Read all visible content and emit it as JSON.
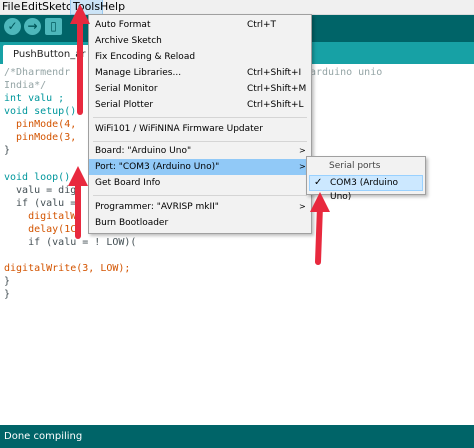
{
  "menubar": {
    "items": [
      "File",
      "Edit",
      "Sketch",
      "Tools",
      "Help"
    ]
  },
  "editor": {
    "tab_label": "PushButton_ar",
    "lines": [
      "/*Dharmendr",
      "India*/",
      "int valu ;",
      "void setup()",
      "  pinMode(4,",
      "  pinMode(3,",
      "}",
      "void loop()",
      "  valu = dig",
      "  if (valu =",
      "    digitalW",
      "    delay(1C",
      "    if (valu = ! LOW)(",
      "digitalWrite(3, LOW);",
      "}",
      "}"
    ],
    "comment_tail": "arduino unio"
  },
  "tools_menu": {
    "items": [
      {
        "label": "Auto Format",
        "shortcut": "Ctrl+T"
      },
      {
        "label": "Archive Sketch",
        "shortcut": ""
      },
      {
        "label": "Fix Encoding & Reload",
        "shortcut": ""
      },
      {
        "label": "Manage Libraries...",
        "shortcut": "Ctrl+Shift+I"
      },
      {
        "label": "Serial Monitor",
        "shortcut": "Ctrl+Shift+M"
      },
      {
        "label": "Serial Plotter",
        "shortcut": "Ctrl+Shift+L"
      },
      {
        "label": "WiFi101 / WiFiNINA Firmware Updater",
        "shortcut": ""
      },
      {
        "label": "Board: \"Arduino Uno\"",
        "shortcut": ""
      },
      {
        "label": "Port: \"COM3 (Arduino Uno)\"",
        "shortcut": ""
      },
      {
        "label": "Get Board Info",
        "shortcut": ""
      },
      {
        "label": "Programmer: \"AVRISP mkII\"",
        "shortcut": ""
      },
      {
        "label": "Burn Bootloader",
        "shortcut": ""
      }
    ],
    "submenu_arrow": ">"
  },
  "port_submenu": {
    "header": "Serial ports",
    "selected": "COM3 (Arduino Uno)",
    "check": "✓"
  },
  "status": {
    "text": "Done compiling"
  },
  "colors": {
    "toolbar": "#006468",
    "tab_strip": "#17a1a5",
    "highlight": "#91c9f7",
    "annotation_arrow": "#e8293e"
  }
}
